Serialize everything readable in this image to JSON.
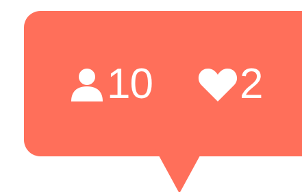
{
  "theme": {
    "accent": "#FF6F5A",
    "foreground": "#FFFFFF"
  },
  "notification": {
    "followers": {
      "icon": "user-icon",
      "count": "10"
    },
    "likes": {
      "icon": "heart-icon",
      "count": "2"
    }
  }
}
